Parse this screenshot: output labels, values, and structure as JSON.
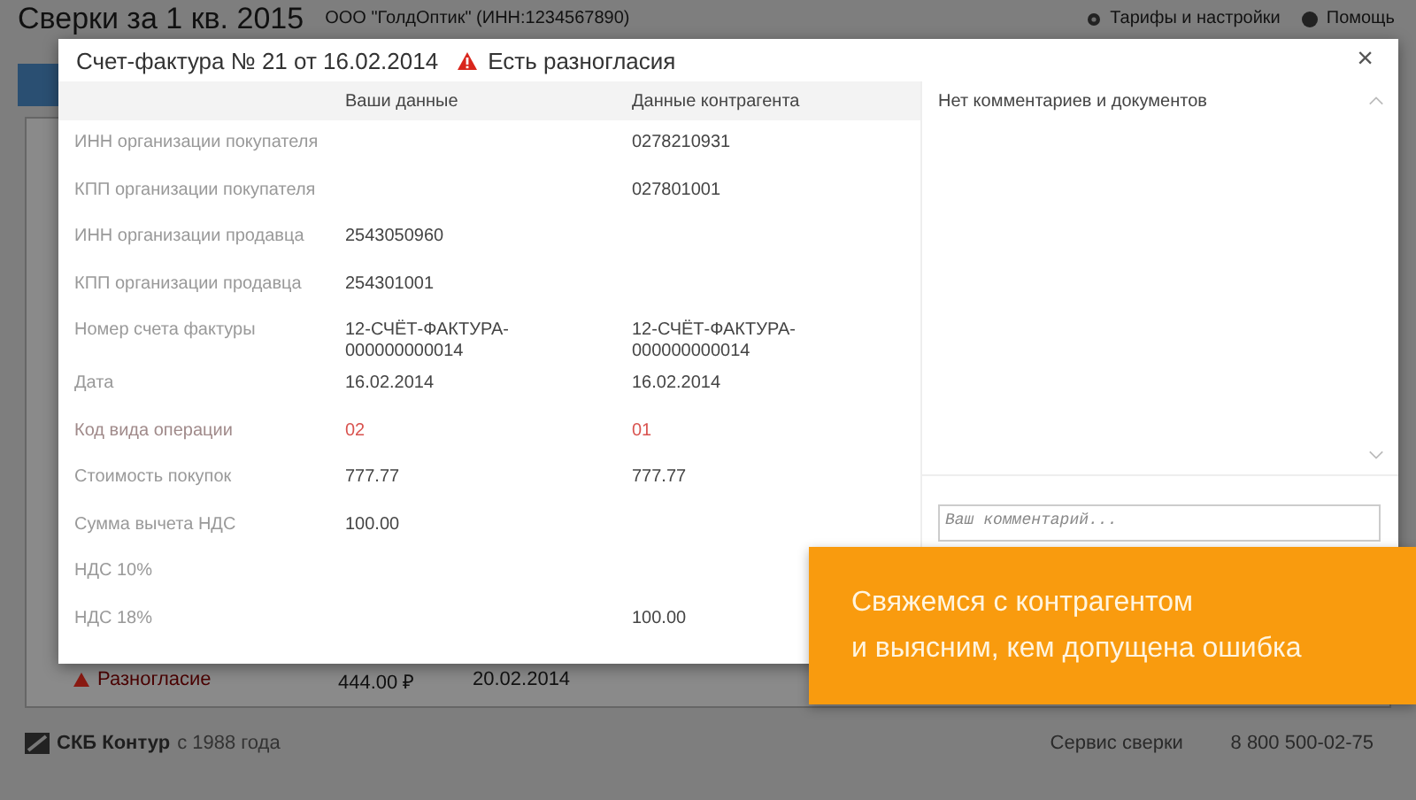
{
  "page": {
    "title": "Сверки за 1 кв. 2015",
    "organization": "ООО \"ГолдОптик\" (ИНН:1234567890)",
    "links": [
      "Тарифы и настройки",
      "Помощь"
    ]
  },
  "background_row": {
    "status": "Разногласие",
    "amount": "444.00 ₽",
    "date": "20.02.2014"
  },
  "footer": {
    "brand": "СКБ Контур",
    "since": "с 1988 года",
    "service": "Сервис сверки",
    "phone": "8 800 500-02-75"
  },
  "modal": {
    "title": "Счет-фактура № 21 от 16.02.2014",
    "status": "Есть разногласия",
    "columns": [
      "Ваши данные",
      "Данные контрагента"
    ],
    "rows": [
      {
        "label": "ИНН организации покупателя",
        "yours": "",
        "theirs": "0278210931",
        "mismatch": false
      },
      {
        "label": "КПП организации покупателя",
        "yours": "",
        "theirs": "027801001",
        "mismatch": false
      },
      {
        "label": "ИНН организации продавца",
        "yours": "2543050960",
        "theirs": "",
        "mismatch": false
      },
      {
        "label": "КПП организации продавца",
        "yours": "254301001",
        "theirs": "",
        "mismatch": false
      },
      {
        "label": "Номер счета фактуры",
        "yours": "12-СЧЁТ-ФАКТУРА-000000000014",
        "theirs": "12-СЧЁТ-ФАКТУРА-000000000014",
        "mismatch": false
      },
      {
        "label": "Дата",
        "yours": "16.02.2014",
        "theirs": "16.02.2014",
        "mismatch": false
      },
      {
        "label": "Код вида операции",
        "yours": "02",
        "theirs": "01",
        "mismatch": true
      },
      {
        "label": "Стоимость покупок",
        "yours": "777.77",
        "theirs": "777.77",
        "mismatch": false
      },
      {
        "label": "Сумма вычета НДС",
        "yours": "100.00",
        "theirs": "",
        "mismatch": false
      },
      {
        "label": "НДС 10%",
        "yours": "",
        "theirs": "",
        "mismatch": false
      },
      {
        "label": "НДС 18%",
        "yours": "",
        "theirs": "100.00",
        "mismatch": false
      }
    ],
    "close": "×",
    "comments_empty": "Нет комментариев и документов",
    "comment_field": {
      "placeholder": "Ваш комментарий..."
    }
  },
  "callout": {
    "lines": [
      "Свяжемся с контрагентом",
      "и выясним, кем допущена ошибка"
    ]
  }
}
